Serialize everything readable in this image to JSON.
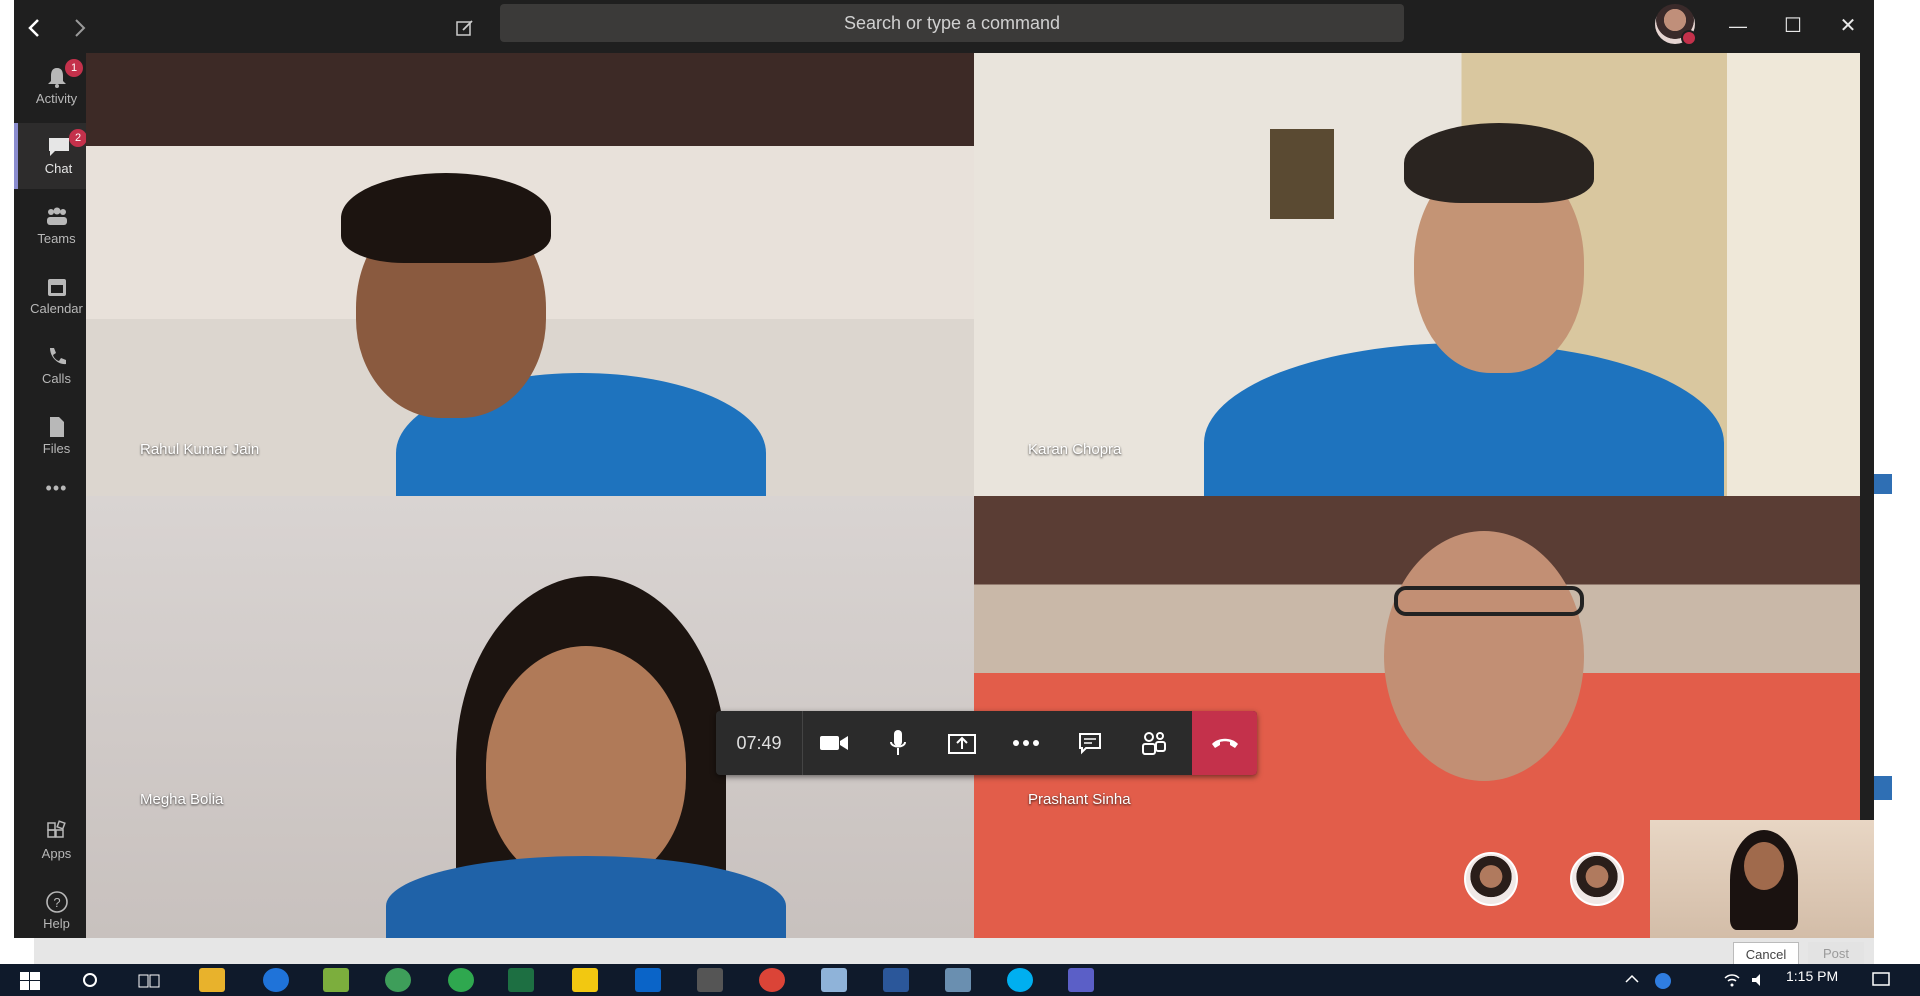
{
  "titlebar": {
    "search_placeholder": "Search or type a command",
    "back_icon": "chevron-left-icon",
    "forward_icon": "chevron-right-icon",
    "compose_icon": "compose-icon",
    "minimize": "—",
    "maximize": "☐",
    "close": "✕"
  },
  "rail": {
    "items": [
      {
        "label": "Activity",
        "icon": "bell-icon",
        "badge": "1"
      },
      {
        "label": "Chat",
        "icon": "chat-icon",
        "badge": "2"
      },
      {
        "label": "Teams",
        "icon": "teams-icon",
        "badge": ""
      },
      {
        "label": "Calendar",
        "icon": "calendar-icon",
        "badge": ""
      },
      {
        "label": "Calls",
        "icon": "phone-icon",
        "badge": ""
      },
      {
        "label": "Files",
        "icon": "files-icon",
        "badge": ""
      }
    ],
    "more": "•••",
    "bottom": [
      {
        "label": "Apps",
        "icon": "apps-icon"
      },
      {
        "label": "Help",
        "icon": "help-icon"
      }
    ]
  },
  "participants": [
    {
      "name": "Rahul Kumar Jain"
    },
    {
      "name": "Karan Chopra"
    },
    {
      "name": "Megha Bolia"
    },
    {
      "name": "Prashant Sinha"
    }
  ],
  "callbar": {
    "timer": "07:49",
    "buttons": [
      "camera-icon",
      "microphone-icon",
      "share-screen-icon",
      "more-icon",
      "chat-icon",
      "participants-icon"
    ],
    "hangup_icon": "hang-up-icon"
  },
  "compose": {
    "cancel_label": "Cancel",
    "post_label": "Post"
  },
  "taskbar": {
    "time": "1:15 PM"
  },
  "colors": {
    "accent": "#8a8cce",
    "hangup": "#c4314b",
    "dark": "#1f1f1f"
  }
}
